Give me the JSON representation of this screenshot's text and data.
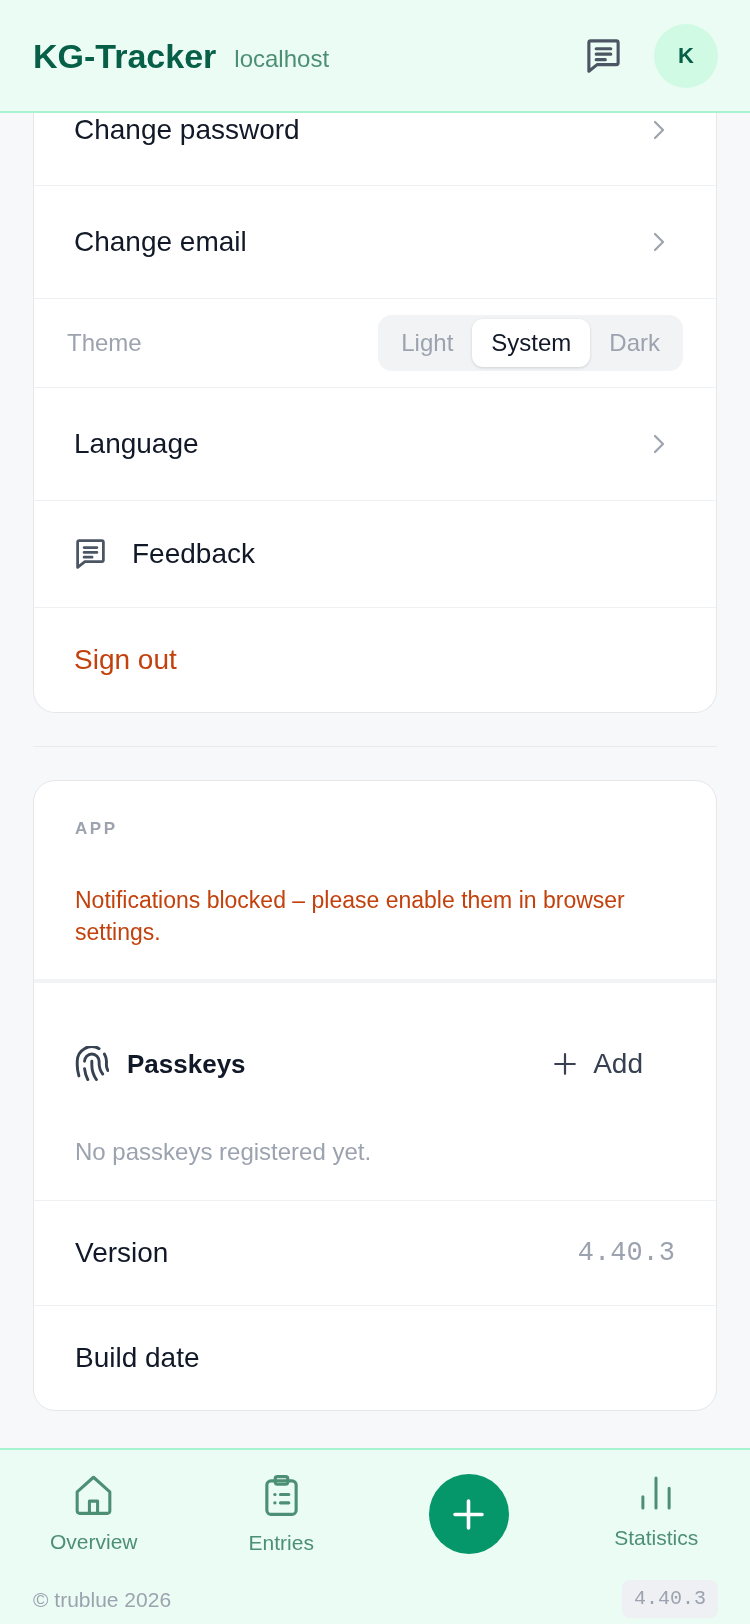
{
  "header": {
    "title": "KG-Tracker",
    "host": "localhost",
    "avatar": "K"
  },
  "account_card": {
    "rows": [
      {
        "kind": "link",
        "label": "Change password"
      },
      {
        "kind": "link",
        "label": "Change email"
      },
      {
        "kind": "choice",
        "label": "Theme",
        "options": [
          {
            "label": "Light",
            "selected": false
          },
          {
            "label": "System",
            "selected": true
          },
          {
            "label": "Dark",
            "selected": false
          }
        ]
      },
      {
        "kind": "link",
        "label": "Language"
      },
      {
        "kind": "feedback",
        "label": "Feedback"
      },
      {
        "kind": "danger",
        "label": "Sign out"
      }
    ]
  },
  "app_card": {
    "heading": "APP",
    "notice": "Notifications blocked – please enable them in browser settings.",
    "passkeys": {
      "title": "Passkeys",
      "add_label": "Add",
      "empty_text": "No passkeys registered yet."
    },
    "rows": [
      {
        "label": "Version",
        "value": "4.40.3"
      },
      {
        "label": "Build date"
      }
    ]
  },
  "bottom_nav": {
    "items": [
      {
        "kind": "tab",
        "label": "Overview",
        "selected": false
      },
      {
        "kind": "tab",
        "label": "Entries",
        "selected": false
      },
      {
        "kind": "action"
      },
      {
        "kind": "tab",
        "label": "Statistics",
        "selected": false
      }
    ]
  },
  "footer": {
    "copyright": "© trublue 2026",
    "version": "4.40.3"
  }
}
